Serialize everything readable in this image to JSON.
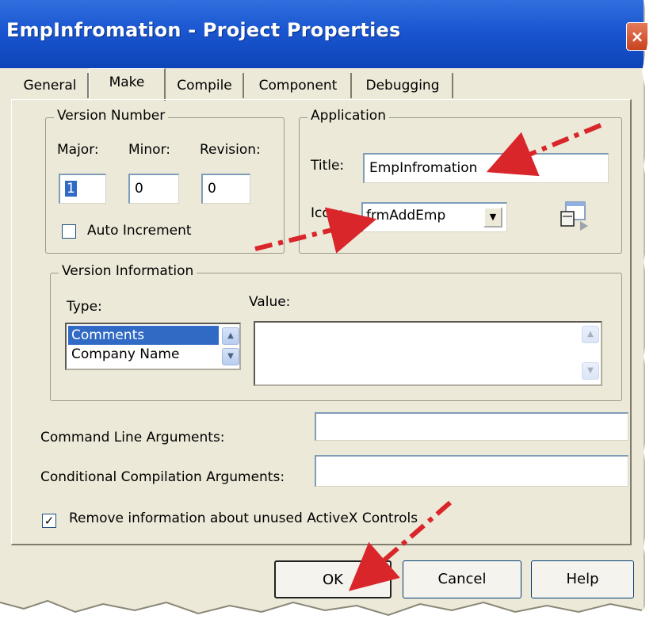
{
  "window": {
    "title": "EmpInfromation - Project Properties",
    "close_label": "×"
  },
  "tabs": [
    {
      "label": "General",
      "active": false
    },
    {
      "label": "Make",
      "active": true
    },
    {
      "label": "Compile",
      "active": false
    },
    {
      "label": "Component",
      "active": false
    },
    {
      "label": "Debugging",
      "active": false
    }
  ],
  "version_number": {
    "legend": "Version Number",
    "major_label": "Major:",
    "minor_label": "Minor:",
    "revision_label": "Revision:",
    "major_value": "1",
    "minor_value": "0",
    "revision_value": "0",
    "auto_increment_label": "Auto Increment",
    "auto_increment_checked": false
  },
  "application": {
    "legend": "Application",
    "title_label": "Title:",
    "title_value": "EmpInfromation",
    "icon_label": "Icon:",
    "icon_value": "frmAddEmp",
    "icon_preview": "form-icon"
  },
  "version_information": {
    "legend": "Version Information",
    "type_label": "Type:",
    "value_label": "Value:",
    "types": [
      "Comments",
      "Company Name"
    ],
    "selected_type": "Comments",
    "value_text": ""
  },
  "command_line": {
    "label": "Command Line Arguments:",
    "value": ""
  },
  "conditional_compilation": {
    "label": "Conditional Compilation Arguments:",
    "value": ""
  },
  "remove_activex": {
    "label": "Remove information about unused ActiveX Controls",
    "checked": true,
    "check_mark": "✓"
  },
  "buttons": {
    "ok": "OK",
    "cancel": "Cancel",
    "help": "Help"
  },
  "annotations": {
    "arrow_color": "#d9262a"
  },
  "colors": {
    "title_bar": "#1a56d0",
    "dialog_bg": "#ece9d8",
    "selection": "#316ac5"
  }
}
